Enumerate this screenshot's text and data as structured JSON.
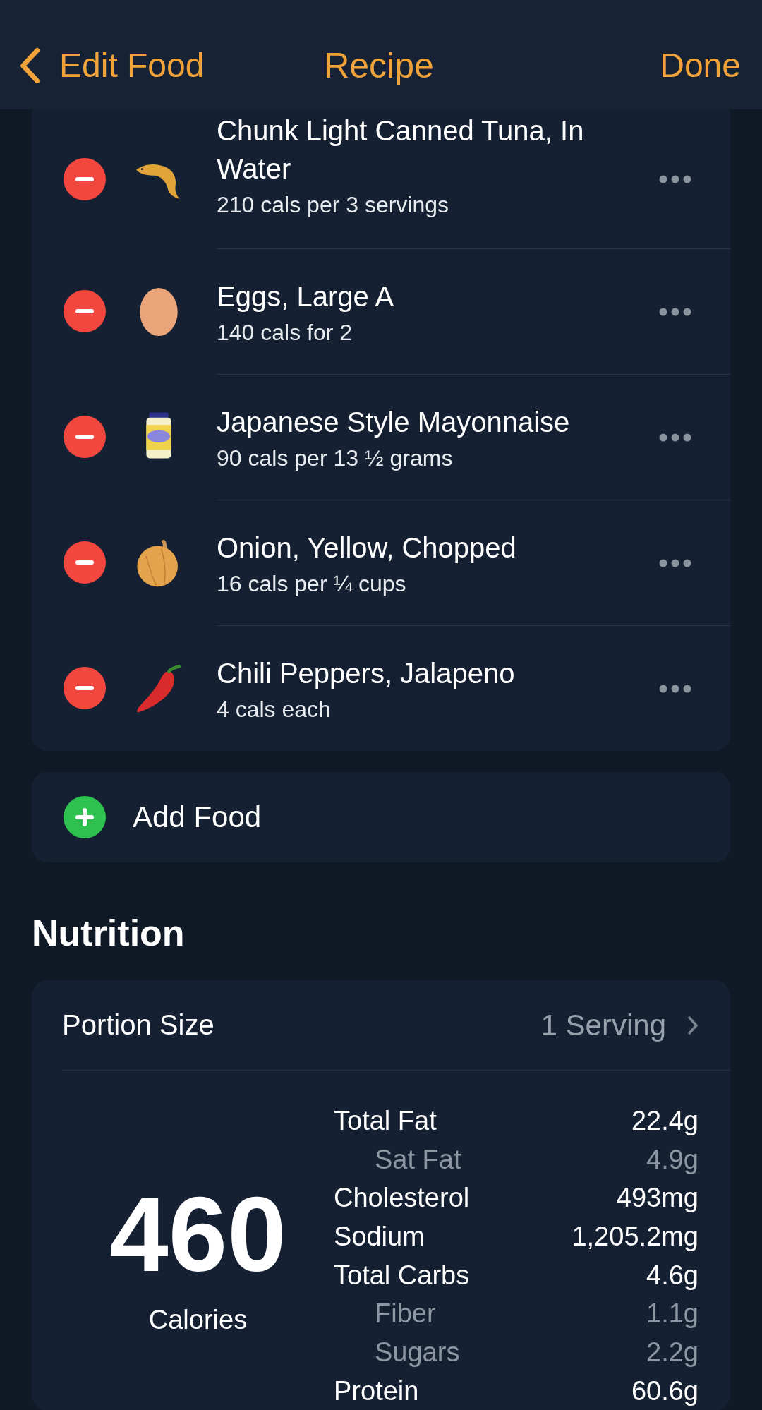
{
  "nav": {
    "back": "Edit Food",
    "title": "Recipe",
    "done": "Done"
  },
  "foods": [
    {
      "name": "Chunk Light Canned Tuna, In Water",
      "detail": "210 cals per 3 servings"
    },
    {
      "name": "Eggs, Large A",
      "detail": "140 cals for 2"
    },
    {
      "name": "Japanese Style Mayonnaise",
      "detail": "90 cals per 13 ½ grams"
    },
    {
      "name": "Onion, Yellow, Chopped",
      "detail": "16 cals per ¼ cups"
    },
    {
      "name": "Chili Peppers, Jalapeno",
      "detail": "4 cals each"
    }
  ],
  "add_food": "Add Food",
  "nutrition": {
    "heading": "Nutrition",
    "portion_label": "Portion Size",
    "portion_value": "1 Serving",
    "calories": "460",
    "calories_label": "Calories",
    "nutrients": [
      {
        "label": "Total Fat",
        "value": "22.4g",
        "sub": false
      },
      {
        "label": "Sat Fat",
        "value": "4.9g",
        "sub": true
      },
      {
        "label": "Cholesterol",
        "value": "493mg",
        "sub": false
      },
      {
        "label": "Sodium",
        "value": "1,205.2mg",
        "sub": false
      },
      {
        "label": "Total Carbs",
        "value": "4.6g",
        "sub": false
      },
      {
        "label": "Fiber",
        "value": "1.1g",
        "sub": true
      },
      {
        "label": "Sugars",
        "value": "2.2g",
        "sub": true
      },
      {
        "label": "Protein",
        "value": "60.6g",
        "sub": false
      }
    ]
  }
}
